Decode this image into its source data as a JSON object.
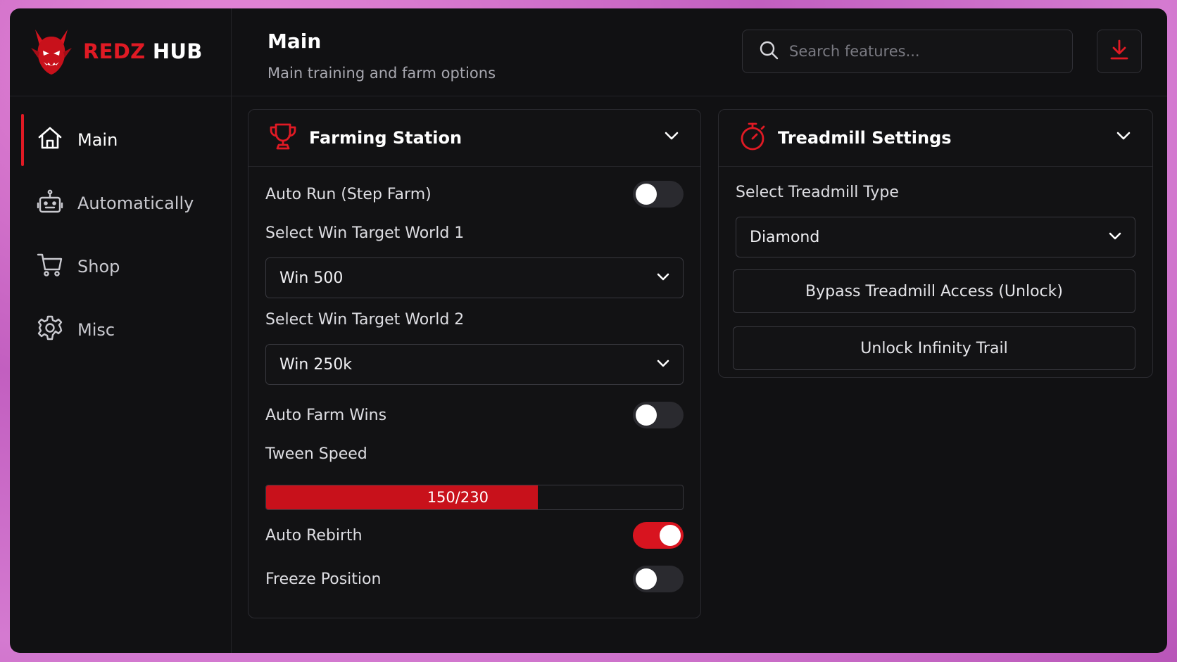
{
  "app": {
    "brand_red": "REDZ",
    "brand_white": "HUB",
    "logo_icon": "demon-logo-icon",
    "accent_color": "#e01a24"
  },
  "sidebar": {
    "items": [
      {
        "label": "Main",
        "icon": "home-icon",
        "active": true
      },
      {
        "label": "Automatically",
        "icon": "robot-icon",
        "active": false
      },
      {
        "label": "Shop",
        "icon": "cart-icon",
        "active": false
      },
      {
        "label": "Misc",
        "icon": "gear-icon",
        "active": false
      }
    ]
  },
  "header": {
    "title": "Main",
    "subtitle": "Main training and farm options",
    "search_placeholder": "Search features...",
    "search_value": "",
    "download_icon": "download-icon"
  },
  "farming": {
    "title": "Farming Station",
    "icon": "trophy-icon",
    "auto_run": {
      "label": "Auto Run (Step Farm)",
      "on": false
    },
    "world1": {
      "label": "Select Win Target World 1",
      "value": "Win 500"
    },
    "world2": {
      "label": "Select Win Target World 2",
      "value": "Win 250k"
    },
    "auto_farm": {
      "label": "Auto Farm Wins",
      "on": false
    },
    "tween": {
      "label": "Tween Speed",
      "value": 150,
      "max": 230,
      "text": "150/230"
    },
    "auto_rebirth": {
      "label": "Auto Rebirth",
      "on": true
    },
    "freeze": {
      "label": "Freeze Position",
      "on": false
    }
  },
  "treadmill": {
    "title": "Treadmill Settings",
    "icon": "stopwatch-icon",
    "type_label": "Select Treadmill Type",
    "type_value": "Diamond",
    "bypass_button": "Bypass Treadmill Access (Unlock)",
    "infinity_button": "Unlock Infinity Trail"
  }
}
